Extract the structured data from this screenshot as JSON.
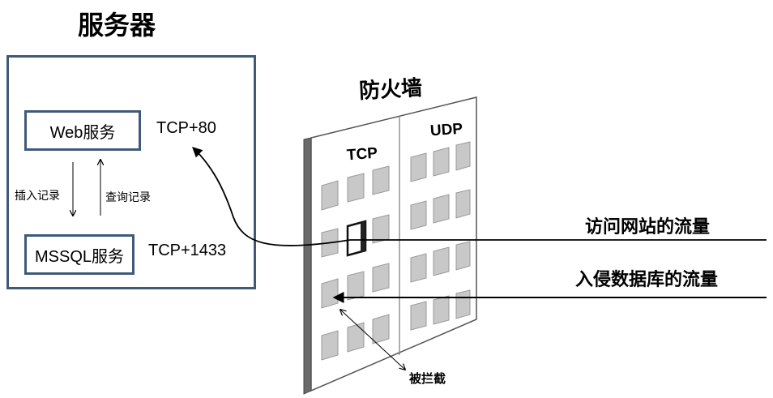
{
  "title": "服务器",
  "server": {
    "web_service": "Web服务",
    "web_port": "TCP+80",
    "db_service": "MSSQL服务",
    "db_port": "TCP+1433",
    "insert_record": "插入记录",
    "query_record": "查询记录"
  },
  "firewall": {
    "title": "防火墙",
    "tcp_label": "TCP",
    "udp_label": "UDP"
  },
  "flows": {
    "web_traffic": "访问网站的流量",
    "attack_traffic": "入侵数据库的流量",
    "blocked": "被拦截"
  },
  "colors": {
    "box_border": "#3f5a78",
    "window_fill": "#c8c8c8",
    "firewall_side": "#6a6a6a"
  }
}
